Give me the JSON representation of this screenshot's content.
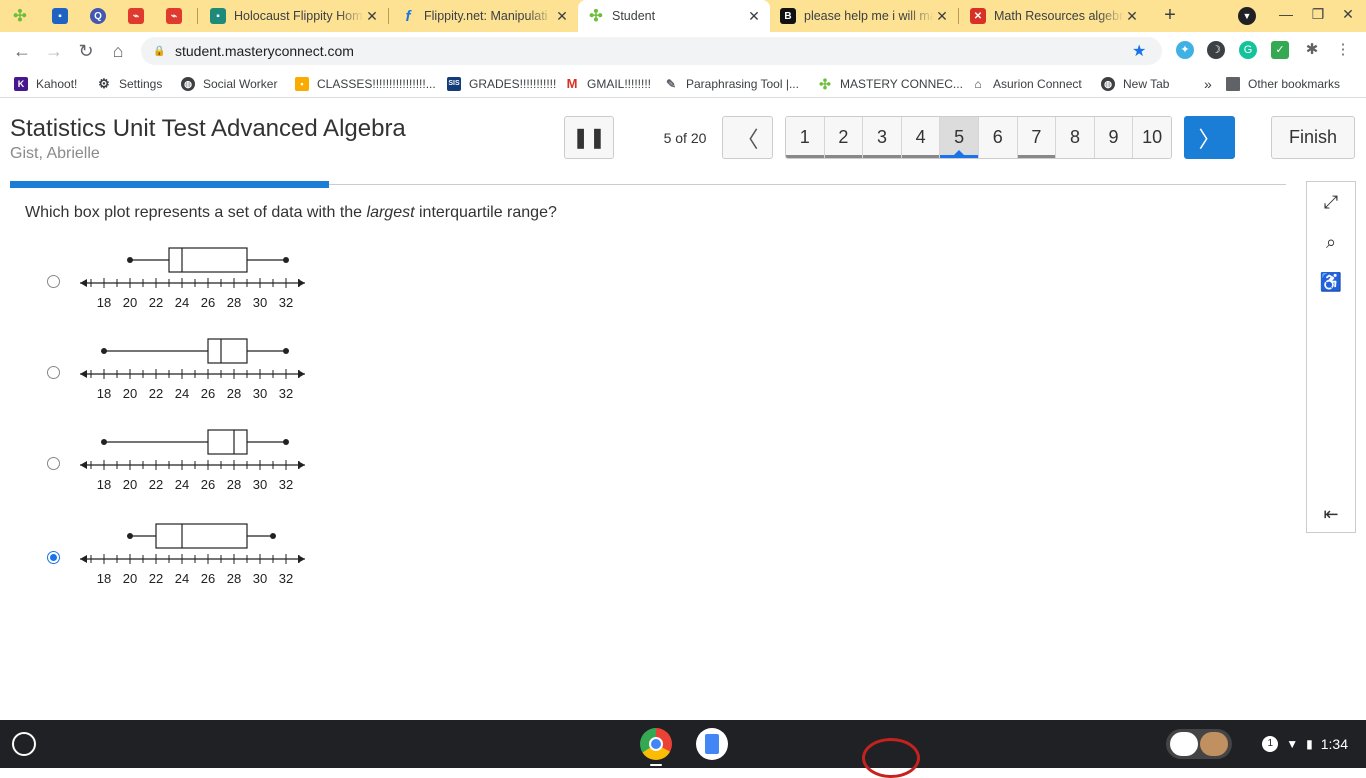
{
  "browser": {
    "tabs": [
      {
        "title": "",
        "icon": "masteryconnect-icon",
        "pinned": true
      },
      {
        "title": "",
        "icon": "classroom-icon",
        "pinned": true
      },
      {
        "title": "",
        "icon": "quizlet-icon",
        "pinned": true
      },
      {
        "title": "",
        "icon": "acrobat-icon",
        "pinned": true
      },
      {
        "title": "",
        "icon": "acrobat-icon",
        "pinned": true
      },
      {
        "title": "Holocaust Flippity Hom",
        "icon": "classroom-icon"
      },
      {
        "title": "Flippity.net: Manipulati",
        "icon": "flippity-icon"
      },
      {
        "title": "Student",
        "icon": "masteryconnect-icon",
        "active": true
      },
      {
        "title": "please help me i will ma",
        "icon": "brainly-icon"
      },
      {
        "title": "Math Resources algebr",
        "icon": "math-resources-icon"
      }
    ],
    "url": "student.masteryconnect.com",
    "bookmarks": [
      "Kahoot!",
      "Settings",
      "Social Worker",
      "CLASSES!!!!!!!!!!!!!!!!...",
      "GRADES!!!!!!!!!!!",
      "GMAIL!!!!!!!!",
      "Paraphrasing Tool |...",
      "MASTERY CONNEC...",
      "Asurion Connect",
      "New Tab"
    ],
    "overflow_label": "»",
    "other_bookmarks": "Other bookmarks"
  },
  "header": {
    "title": "Statistics Unit Test Advanced Algebra",
    "student": "Gist, Abrielle",
    "question_counter": "5 of 20",
    "question_numbers": [
      "1",
      "2",
      "3",
      "4",
      "5",
      "6",
      "7",
      "8",
      "9",
      "10"
    ],
    "current_question": "5",
    "answered_questions": [
      "1",
      "2",
      "3",
      "4",
      "5",
      "7"
    ],
    "finish_label": "Finish",
    "progress_fraction": 0.25
  },
  "question": {
    "before": "Which box plot represents a set of data with the ",
    "emphasis": "largest",
    "after": " interquartile range?"
  },
  "choices": [
    {
      "min": 20,
      "q1": 23,
      "median": 24,
      "q3": 29,
      "max": 32,
      "selected": false
    },
    {
      "min": 18,
      "q1": 26,
      "median": 27,
      "q3": 29,
      "max": 32,
      "selected": false
    },
    {
      "min": 18,
      "q1": 26,
      "median": 28,
      "q3": 29,
      "max": 32,
      "selected": false
    },
    {
      "min": 20,
      "q1": 22,
      "median": 24,
      "q3": 29,
      "max": 31,
      "selected": true
    }
  ],
  "axis": {
    "ticks": [
      "18",
      "20",
      "22",
      "24",
      "26",
      "28",
      "30",
      "32"
    ],
    "min": 18,
    "max": 32
  },
  "system": {
    "time": "1:34",
    "notification_count": "1"
  },
  "colors": {
    "accent": "#1a7ed6",
    "tabstrip": "#fde293",
    "taskbar": "#202124"
  }
}
